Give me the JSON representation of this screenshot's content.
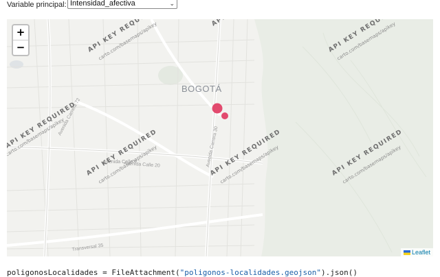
{
  "controls": {
    "variable_label": "Variable principal:",
    "variable_selected": "Intensidad_afectiva"
  },
  "map": {
    "city_label": "BOGOTÁ",
    "watermark_line1": "API KEY REQUIRED",
    "watermark_line2": "carto.com/basemaps/apikey",
    "streets": {
      "carrera72": "Avenida Carrera 72",
      "calle20": "Avenida Calle 20",
      "carrera30": "Avenida Carrera 30",
      "calle9": "Avenida Calle 9",
      "transversal": "Transversal 35"
    },
    "zoom_in": "+",
    "zoom_out": "−",
    "attribution": "Leaflet",
    "marker_color": "#e0375f",
    "markers": [
      {
        "label": "large",
        "value": 2
      },
      {
        "label": "small",
        "value": 1
      }
    ]
  },
  "code": {
    "prefix": "poligonosLocalidades = FileAttachment(",
    "string": "\"poligonos-localidades.geojson\"",
    "suffix": ").json()"
  }
}
